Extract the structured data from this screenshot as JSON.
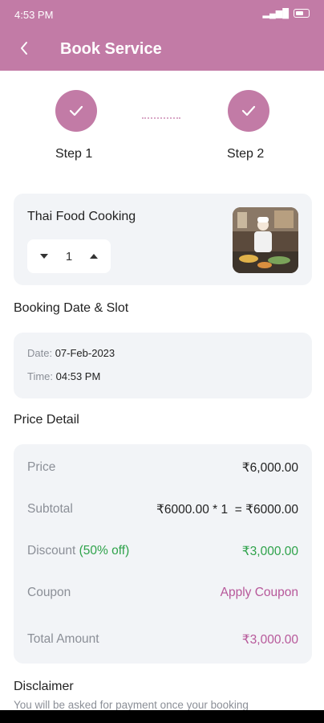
{
  "status_bar": {
    "time": "4:53 PM",
    "battery": "69"
  },
  "header": {
    "title": "Book Service"
  },
  "steps": [
    {
      "label": "Step 1",
      "done": true
    },
    {
      "label": "Step 2",
      "done": true
    }
  ],
  "service": {
    "name": "Thai Food Cooking",
    "quantity": "1",
    "image_icon": "chef-cooking-photo"
  },
  "booking": {
    "section_title": "Booking Date & Slot",
    "date_label": "Date:",
    "date_value": "07-Feb-2023",
    "time_label": "Time:",
    "time_value": "04:53 PM"
  },
  "price": {
    "section_title": "Price Detail",
    "price_label": "Price",
    "price_value": "₹6,000.00",
    "subtotal_label": "Subtotal",
    "subtotal_value": "₹6000.00 * 1  = ₹6000.00",
    "discount_label": "Discount",
    "discount_percent": "(50% off)",
    "discount_value": "₹3,000.00",
    "coupon_label": "Coupon",
    "coupon_action": "Apply Coupon",
    "total_label": "Total Amount",
    "total_value": "₹3,000.00"
  },
  "disclaimer": {
    "title": "Disclaimer",
    "text": "You will be asked for payment once your booking"
  },
  "colors": {
    "primary": "#c27ba6",
    "accent_pink": "#b7589a",
    "green": "#2ea24a",
    "card_bg": "#f2f4f7"
  }
}
